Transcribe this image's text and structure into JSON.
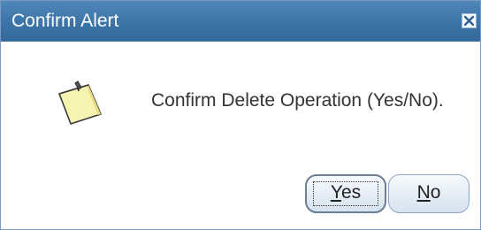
{
  "window": {
    "title": "Confirm Alert",
    "close_icon": "close-icon"
  },
  "alert": {
    "icon": "note-icon",
    "message": "Confirm Delete Operation (Yes/No)."
  },
  "buttons": {
    "yes": {
      "mnemonic": "Y",
      "rest": "es",
      "focused": true
    },
    "no": {
      "mnemonic": "N",
      "rest": "o"
    }
  },
  "colors": {
    "titlebar": "#3c74a8",
    "title_text": "#ffffff",
    "button_border": "#8da8c4",
    "note_fill": "#f7f3b0"
  }
}
